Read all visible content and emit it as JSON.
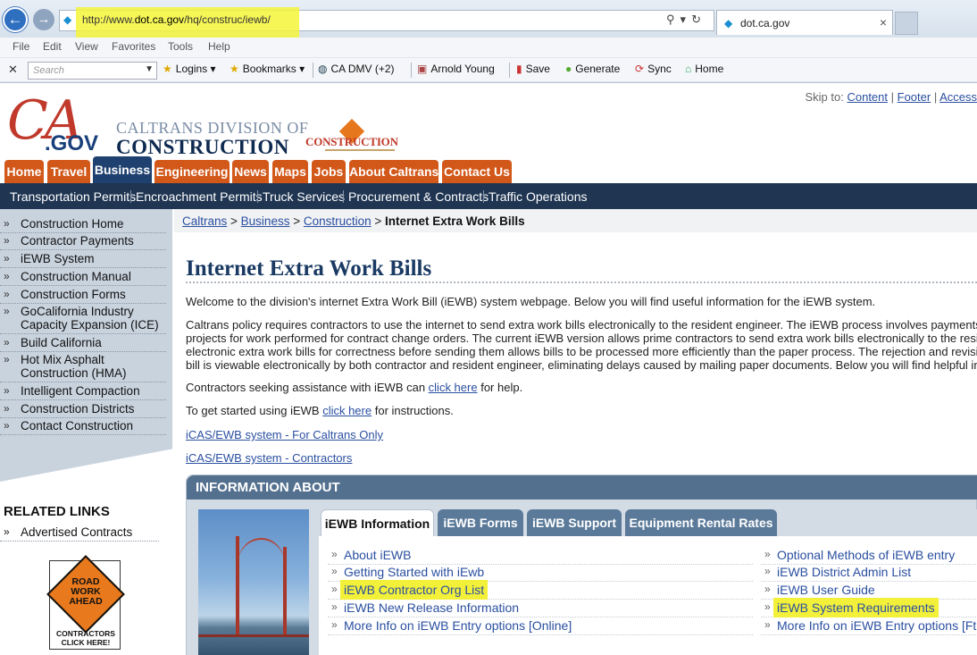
{
  "browser": {
    "url_prefix": "http://www.",
    "url_host": "dot.ca.gov",
    "url_path": "/hq/construc/iewb/",
    "tab_title": "dot.ca.gov",
    "menu": [
      "File",
      "Edit",
      "View",
      "Favorites",
      "Tools",
      "Help"
    ],
    "search_placeholder": "Search",
    "favorites": [
      {
        "label": "Logins",
        "icon": "star-icon"
      },
      {
        "label": "Bookmarks",
        "icon": "star-icon"
      },
      {
        "label": "CA DMV (+2)",
        "icon": "globe-icon"
      },
      {
        "label": "Arnold Young",
        "icon": "person-card-icon"
      },
      {
        "label": "Save",
        "icon": "save-icon"
      },
      {
        "label": "Generate",
        "icon": "generate-icon"
      },
      {
        "label": "Sync",
        "icon": "sync-icon"
      },
      {
        "label": "Home",
        "icon": "home-icon"
      }
    ]
  },
  "header": {
    "skip_to": "Skip to:",
    "skip_links": [
      "Content",
      "Footer",
      "Access"
    ],
    "logo_ca": "CA",
    "logo_gov": ".GOV",
    "division_line1": "CALTRANS DIVISION OF",
    "division_line2": "CONSTRUCTION",
    "division_logo_text": "CONSTRUCTION"
  },
  "main_tabs": [
    "Home",
    "Travel",
    "Business",
    "Engineering",
    "News",
    "Maps",
    "Jobs",
    "About Caltrans",
    "Contact Us"
  ],
  "active_main_tab": "Business",
  "sub_nav": [
    "Transportation Permits",
    "Encroachment Permits",
    "Truck Services",
    "Procurement & Contracts",
    "Traffic Operations"
  ],
  "left_nav": [
    "Construction Home",
    "Contractor Payments",
    "iEWB System",
    "Construction Manual",
    "Construction Forms",
    "GoCalifornia Industry Capacity Expansion (ICE)",
    "Build California",
    "Hot Mix Asphalt Construction (HMA)",
    "Intelligent Compaction",
    "Construction Districts",
    "Contact Construction"
  ],
  "related": {
    "heading": "RELATED LINKS",
    "links": [
      "Advertised Contracts"
    ],
    "sign_line1": "ROAD",
    "sign_line2": "WORK",
    "sign_line3": "AHEAD",
    "sign_caption1": "CONTRACTORS",
    "sign_caption2": "CLICK HERE!"
  },
  "breadcrumb": {
    "links": [
      "Caltrans",
      "Business",
      "Construction"
    ],
    "sep": " > ",
    "current": "Internet Extra Work Bills"
  },
  "content": {
    "title": "Internet Extra Work Bills",
    "welcome": "Welcome to the division's internet Extra Work Bill (iEWB) system webpage. Below you will find useful information for the iEWB system.",
    "policy_lines": [
      "Caltrans policy requires contractors to use the internet to send extra work bills electronically to the resident engineer. The iEWB process involves payments r",
      "projects for work performed for contract change orders. The current iEWB version allows prime contractors to send extra work bills electronically to the reside",
      "electronic extra work bills for correctness before sending them allows bills to be processed more efficiently than the paper process. The rejection and revisior",
      "bill is viewable electronically by both contractor and resident engineer, eliminating delays caused by mailing paper documents. Below you will find helpful info"
    ],
    "assist_pre": "Contractors seeking assistance with iEWB can ",
    "assist_link": "click here",
    "assist_post": " for help.",
    "start_pre": "To get started using iEWB ",
    "start_link": "click here",
    "start_post": " for instructions.",
    "icas_caltrans": "iCAS/EWB system - For Caltrans Only",
    "icas_contractors": "iCAS/EWB system - Contractors"
  },
  "info_box": {
    "heading": "INFORMATION ABOUT",
    "tabs": [
      "iEWB Information",
      "iEWB Forms",
      "iEWB Support",
      "Equipment Rental Rates"
    ],
    "active_tab": "iEWB Information",
    "left_links": [
      "About iEWB",
      "Getting Started with iEwb",
      "iEWB Contractor Org List",
      "iEWB New Release Information",
      "More Info on iEWB Entry options [Online]"
    ],
    "right_links": [
      "Optional Methods of iEWB entry",
      "iEWB District Admin List",
      "iEWB User Guide",
      "iEWB System Requirements",
      "More Info on iEWB Entry options [Ftp]"
    ],
    "highlight_color": "#f3f03a"
  },
  "colors": {
    "orange_tab": "#d2581a",
    "navy": "#1f3552",
    "link": "#2a4fa0",
    "highlight": "#f5f53a"
  }
}
